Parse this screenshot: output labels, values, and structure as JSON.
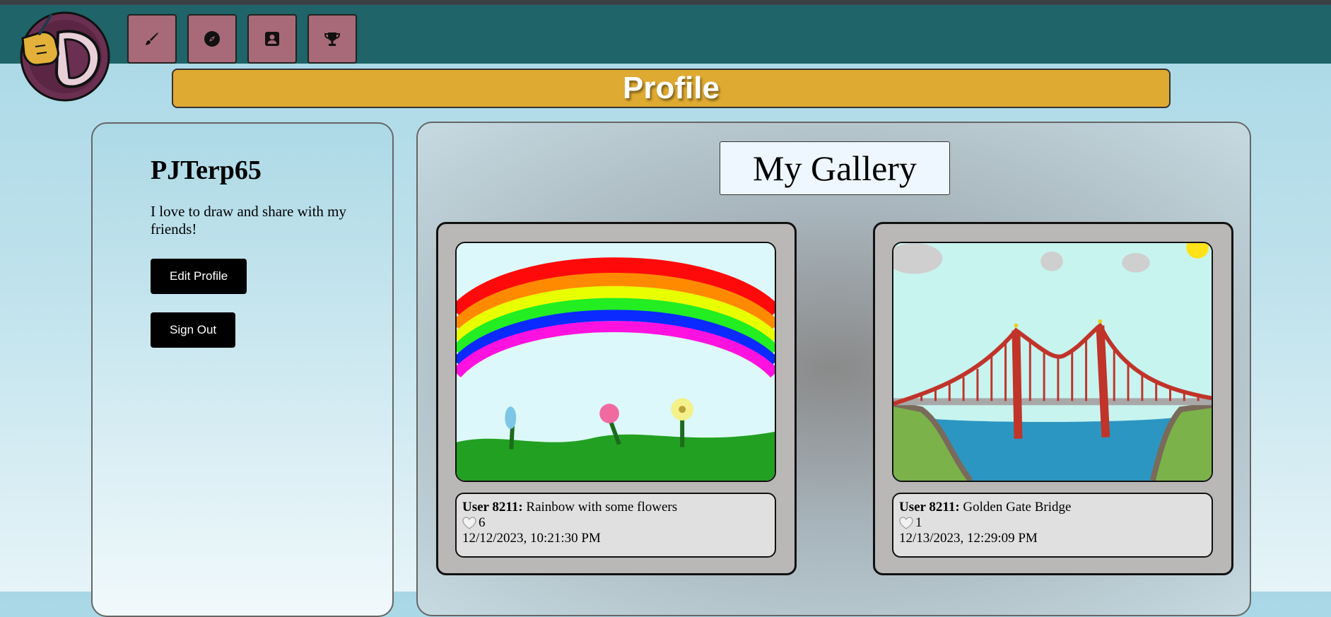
{
  "page": {
    "title": "Profile"
  },
  "nav": {
    "items": [
      {
        "name": "draw",
        "icon": "brush-icon"
      },
      {
        "name": "explore",
        "icon": "compass-icon"
      },
      {
        "name": "profile",
        "icon": "profile-card-icon"
      },
      {
        "name": "leaderboard",
        "icon": "trophy-icon"
      }
    ]
  },
  "logo": {
    "icon": "hand-holding-d-logo"
  },
  "profile": {
    "username": "PJTerp65",
    "bio": "I love to draw and share with my friends!",
    "edit_label": "Edit Profile",
    "signout_label": "Sign Out"
  },
  "gallery": {
    "title": "My Gallery",
    "posts": [
      {
        "author": "User 8211:",
        "caption": "Rainbow with some flowers",
        "likes": "6",
        "timestamp": "12/12/2023, 10:21:30 PM"
      },
      {
        "author": "User 8211:",
        "caption": "Golden Gate Bridge",
        "likes": "1",
        "timestamp": "12/13/2023, 12:29:09 PM"
      }
    ]
  },
  "colors": {
    "topbar": "#1e6468",
    "nav_button": "#a86a78",
    "banner": "#dfaa31"
  }
}
